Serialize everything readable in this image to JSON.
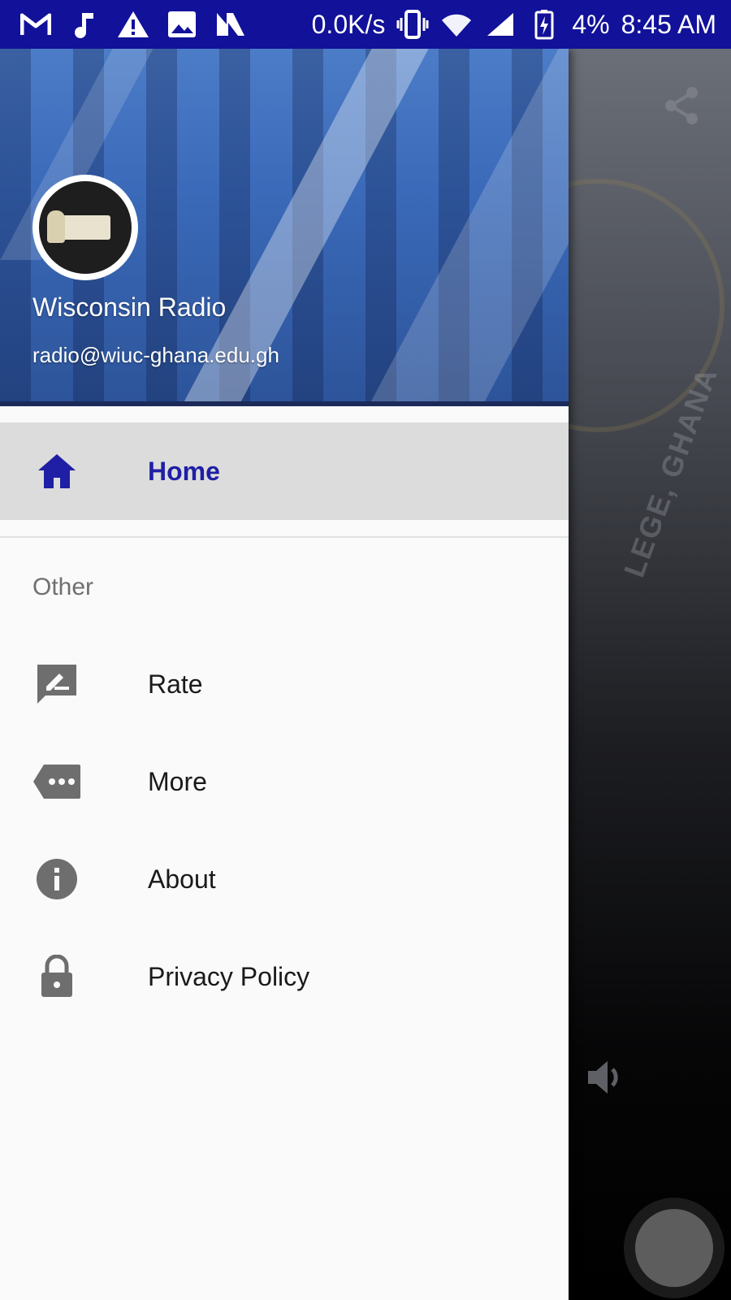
{
  "status_bar": {
    "net_speed": "0.0K/s",
    "battery": "4%",
    "time": "8:45 AM",
    "icons": [
      "gmail-icon",
      "music-note-icon",
      "warning-icon",
      "image-icon",
      "n-app-icon",
      "vibrate-icon",
      "wifi-icon",
      "signal-icon",
      "battery-charging-icon"
    ]
  },
  "drawer": {
    "header": {
      "title": "Wisconsin Radio",
      "email": "radio@wiuc-ghana.edu.gh"
    },
    "primary_items": [
      {
        "label": "Home",
        "icon": "home-icon",
        "active": true
      }
    ],
    "section": {
      "label": "Other",
      "items": [
        {
          "label": "Rate",
          "icon": "rate-review-icon"
        },
        {
          "label": "More",
          "icon": "more-label-icon"
        },
        {
          "label": "About",
          "icon": "info-icon"
        },
        {
          "label": "Privacy Policy",
          "icon": "lock-icon"
        }
      ]
    }
  },
  "background_app": {
    "emblem_text": "LEGE, GHANA",
    "icons": [
      "share-icon",
      "volume-icon"
    ]
  },
  "colors": {
    "status_bar": "#11119a",
    "active_label": "#1f1fa5",
    "active_row_bg": "#dcdcdc",
    "icon_gray": "#6e6e6e"
  }
}
